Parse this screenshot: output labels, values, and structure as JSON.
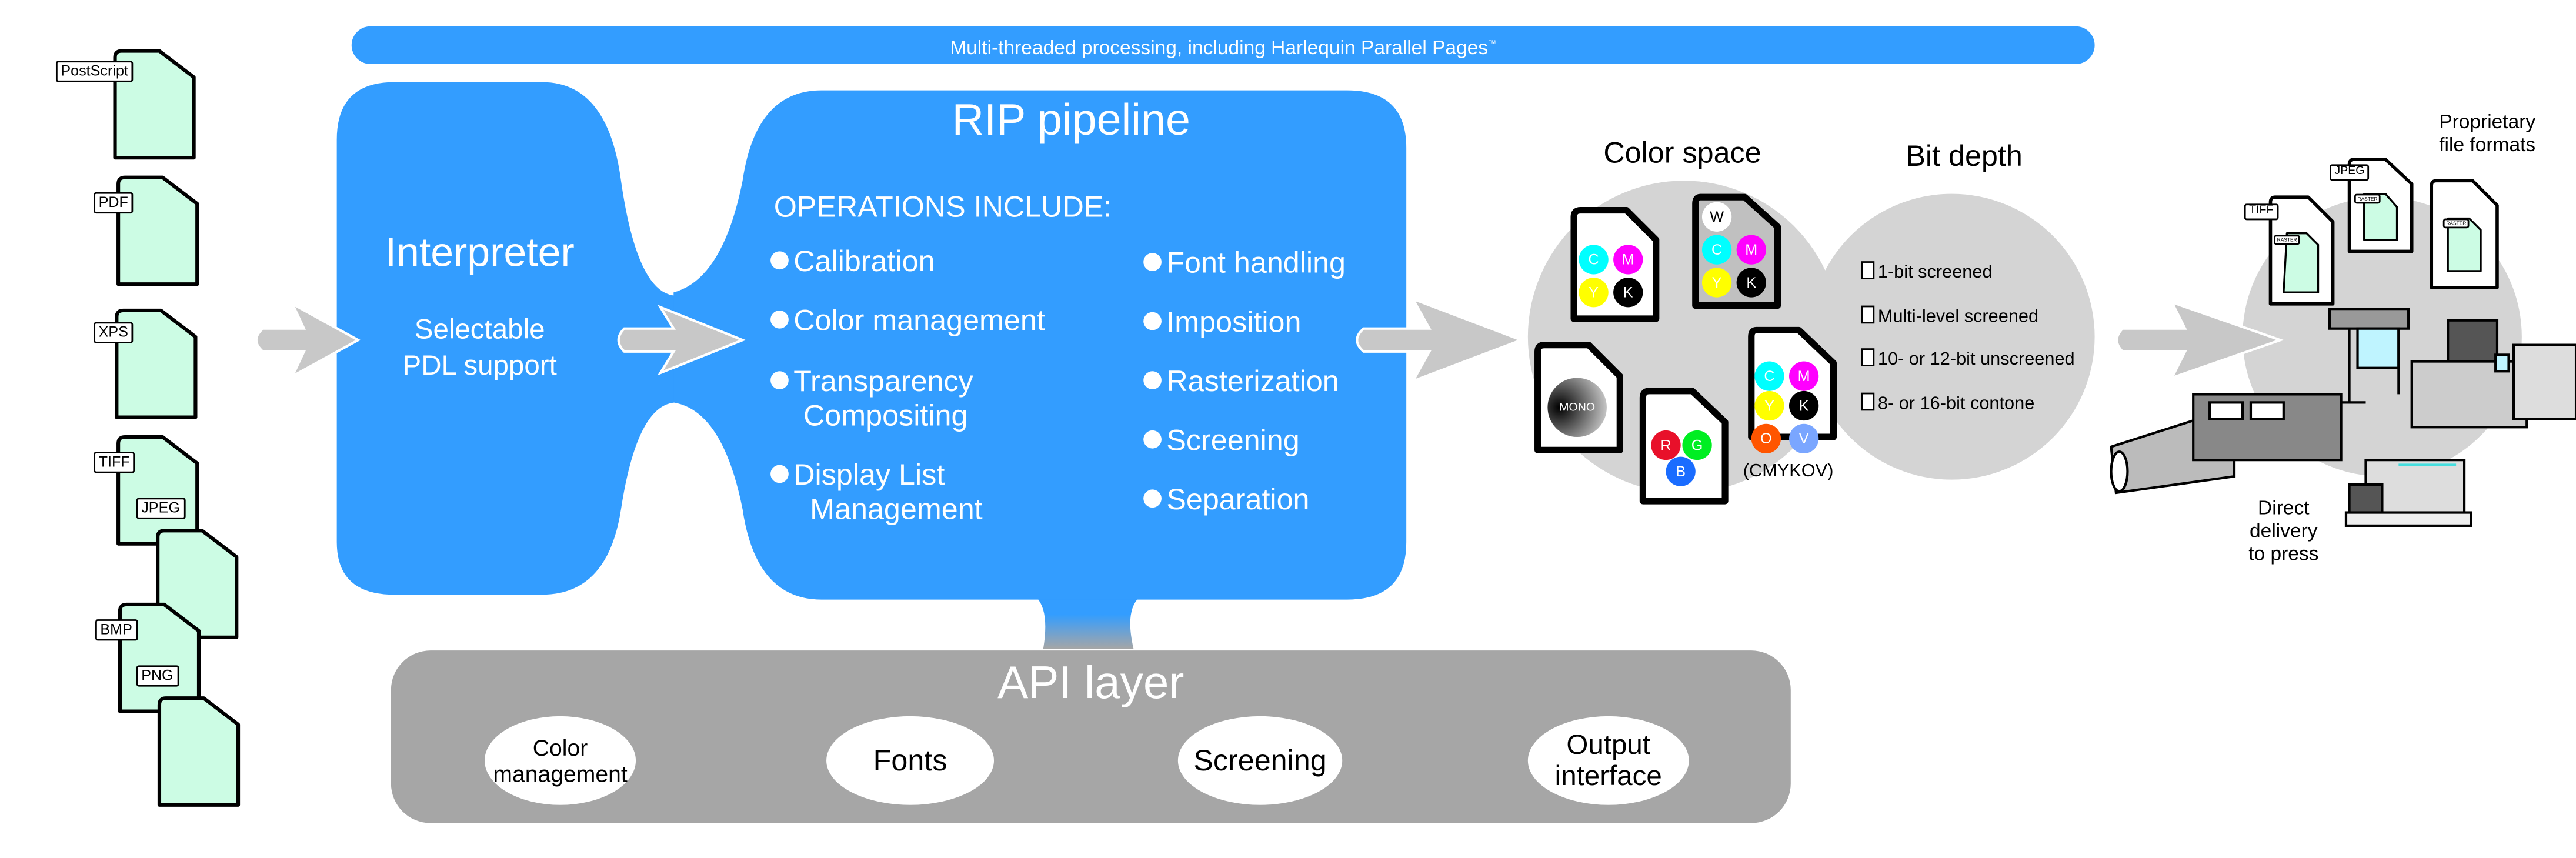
{
  "banner": {
    "text": "Multi-threaded processing, including Harlequin Parallel Pages",
    "trademark": "™"
  },
  "input_files": [
    {
      "label": "PostScript"
    },
    {
      "label": "PDF"
    },
    {
      "label": "XPS"
    },
    {
      "label": "TIFF"
    },
    {
      "label": "JPEG"
    },
    {
      "label": "BMP"
    },
    {
      "label": "PNG"
    }
  ],
  "interpreter": {
    "title": "Interpreter",
    "subtitle_line1": "Selectable",
    "subtitle_line2": "PDL support"
  },
  "rip_pipeline": {
    "title": "RIP pipeline",
    "ops_heading": "OPERATIONS INCLUDE:",
    "left_ops": [
      {
        "line1": "Calibration",
        "line2": ""
      },
      {
        "line1": "Color management",
        "line2": ""
      },
      {
        "line1": "Transparency",
        "line2": "Compositing"
      },
      {
        "line1": "Display List",
        "line2": "Management"
      }
    ],
    "right_ops": [
      {
        "line1": "Font handling"
      },
      {
        "line1": "Imposition"
      },
      {
        "line1": "Rasterization"
      },
      {
        "line1": "Screening"
      },
      {
        "line1": "Separation"
      }
    ]
  },
  "color_space": {
    "title": "Color space",
    "cmyk": [
      "C",
      "M",
      "Y",
      "K"
    ],
    "wcmyk": [
      "W",
      "C",
      "M",
      "Y",
      "K"
    ],
    "mono": "MONO",
    "rgb": [
      "R",
      "G",
      "B"
    ],
    "cmykov": [
      "C",
      "M",
      "Y",
      "K",
      "O",
      "V"
    ],
    "cmykov_caption": "(CMYKOV)",
    "colors": {
      "C": "#00ffff",
      "M": "#ff00ff",
      "Y": "#ffff00",
      "K": "#000000",
      "W": "#ffffff",
      "R": "#e8102a",
      "G": "#00ee22",
      "B": "#1a6cff",
      "O": "#ff5500",
      "V": "#7aa6ff"
    }
  },
  "bit_depth": {
    "title": "Bit depth",
    "items": [
      "1-bit screened",
      "Multi-level screened",
      "10- or 12-bit unscreened",
      "8- or 16-bit contone"
    ]
  },
  "output": {
    "proprietary_line1": "Proprietary",
    "proprietary_line2": "file formats",
    "files": [
      {
        "label": "TIFF",
        "inner": "RASTER"
      },
      {
        "label": "JPEG",
        "inner": "RASTER"
      },
      {
        "label": "",
        "inner": "RASTER"
      }
    ],
    "direct_line1": "Direct",
    "direct_line2": "delivery",
    "direct_line3": "to press"
  },
  "api_layer": {
    "title": "API layer",
    "modules": [
      {
        "line1": "Color",
        "line2": "management"
      },
      {
        "line1": "Fonts",
        "line2": ""
      },
      {
        "line1": "Screening",
        "line2": ""
      },
      {
        "line1": "Output",
        "line2": "interface"
      }
    ]
  },
  "theme": {
    "blue": "#339dff",
    "gray_bubble": "#d4d4d4",
    "api_gray": "#a6a6a6",
    "arrow_gray": "#c8c8c8",
    "file_green": "#ccfce4"
  }
}
